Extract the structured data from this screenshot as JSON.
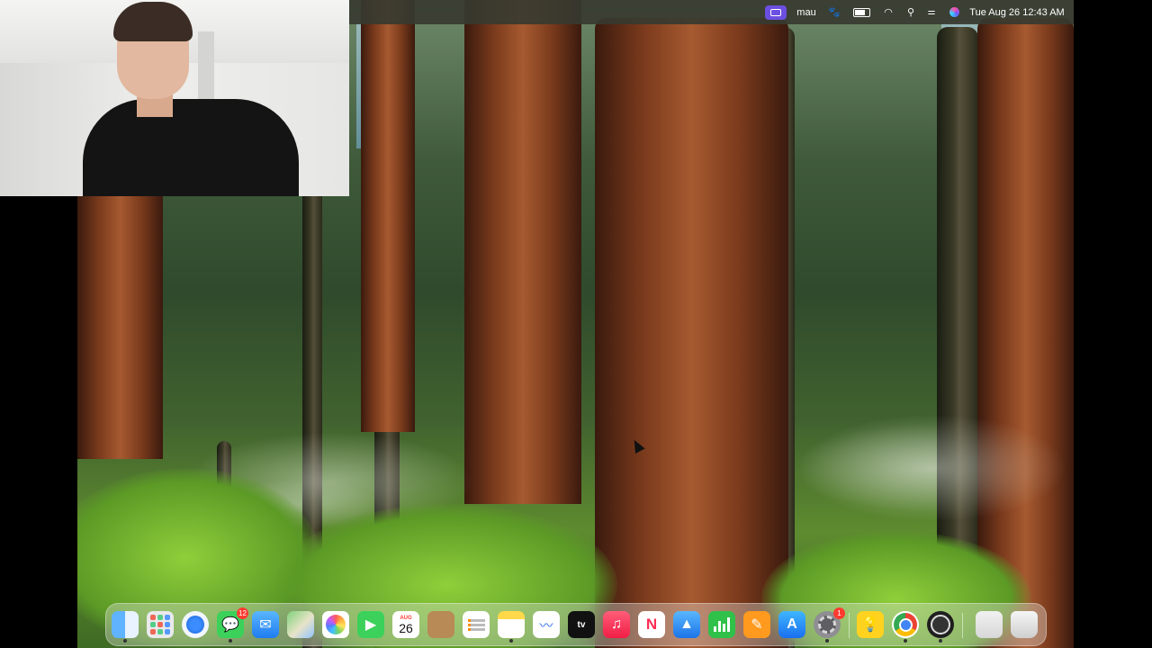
{
  "menubar": {
    "user": "mau",
    "clock": "Tue Aug 26  12:43 AM",
    "icons": {
      "control": "screen-mirroring-icon",
      "paw": "paw-icon",
      "battery": "battery-icon",
      "wifi": "wifi-icon",
      "search": "spotlight-search-icon",
      "control_center": "control-center-icon",
      "siri": "siri-icon"
    }
  },
  "dock": {
    "apps": [
      {
        "name": "finder",
        "icon": "finder-icon",
        "running": true
      },
      {
        "name": "launchpad",
        "icon": "launchpad-icon",
        "running": false
      },
      {
        "name": "safari",
        "icon": "safari-icon",
        "running": false
      },
      {
        "name": "messages",
        "icon": "messages-icon",
        "running": true,
        "badge": "12"
      },
      {
        "name": "mail",
        "icon": "mail-icon",
        "running": false
      },
      {
        "name": "maps",
        "icon": "maps-icon",
        "running": false
      },
      {
        "name": "photos",
        "icon": "photos-icon",
        "running": false
      },
      {
        "name": "facetime",
        "icon": "facetime-icon",
        "running": false
      },
      {
        "name": "calendar",
        "icon": "calendar-icon",
        "running": false,
        "month": "AUG",
        "day": "26"
      },
      {
        "name": "notes-folder",
        "icon": "contacts-icon",
        "running": false
      },
      {
        "name": "reminders",
        "icon": "reminders-icon",
        "running": false
      },
      {
        "name": "notes",
        "icon": "notes-icon",
        "running": true
      },
      {
        "name": "freeform",
        "icon": "freeform-icon",
        "running": false
      },
      {
        "name": "tv",
        "icon": "apple-tv-icon",
        "running": false,
        "label": "tv"
      },
      {
        "name": "music",
        "icon": "music-icon",
        "running": false
      },
      {
        "name": "news",
        "icon": "news-icon",
        "running": false
      },
      {
        "name": "keynote",
        "icon": "keynote-icon",
        "running": false
      },
      {
        "name": "numbers",
        "icon": "numbers-icon",
        "running": false
      },
      {
        "name": "pages",
        "icon": "pages-icon",
        "running": false
      },
      {
        "name": "app-store",
        "icon": "app-store-icon",
        "running": false
      },
      {
        "name": "system-settings",
        "icon": "settings-gear-icon",
        "running": true,
        "badge": "1"
      },
      {
        "name": "tips",
        "icon": "tips-lightbulb-icon",
        "running": false
      },
      {
        "name": "chrome",
        "icon": "chrome-icon",
        "running": true
      },
      {
        "name": "obs",
        "icon": "obs-icon",
        "running": true
      },
      {
        "name": "documents",
        "icon": "folder-stack-icon",
        "running": false
      },
      {
        "name": "trash",
        "icon": "trash-icon",
        "running": false
      }
    ]
  },
  "colors": {
    "menubar_bg": "#373a30",
    "accent_purple": "#6b4fe0",
    "badge_red": "#ff3b30"
  }
}
